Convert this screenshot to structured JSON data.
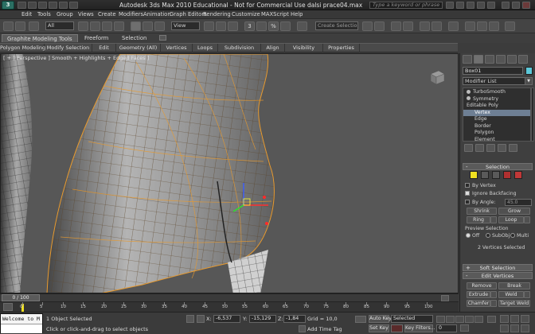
{
  "app": {
    "logo_label": "3",
    "title": "Autodesk 3ds Max  2010  Educational - Not for Commercial Use     dalsi prace04.max",
    "help_search_placeholder": "Type a keyword or phrase"
  },
  "menu": [
    "Edit",
    "Tools",
    "Group",
    "Views",
    "Create",
    "Modifiers",
    "Animation",
    "Graph Editors",
    "Rendering",
    "Customize",
    "MAXScript",
    "Help"
  ],
  "toolbar": {
    "selection_filter": "All",
    "ref_coord": "View",
    "snap_label": "3",
    "percent_snap": "%",
    "named_selection_placeholder": "Create Selection Se"
  },
  "ribbon": {
    "tabs": [
      "Graphite Modeling Tools",
      "Freeform",
      "Selection"
    ],
    "panels": [
      "Polygon Modeling",
      "Modify Selection",
      "Edit",
      "Geometry (All)",
      "Vertices",
      "Loops",
      "Subdivision",
      "Align",
      "Visibility",
      "Properties"
    ]
  },
  "viewport": {
    "label": "[ + ] Perspective  ] Smooth + Highlights + Edged Faces ]"
  },
  "command_panel": {
    "object_name": "Box01",
    "object_color": "#5cc8d9",
    "modifier_list": "Modifier List",
    "stack": [
      {
        "label": "TurboSmooth"
      },
      {
        "label": "Symmetry"
      },
      {
        "label": "Editable Poly"
      },
      {
        "label": "Vertex"
      },
      {
        "label": "Edge"
      },
      {
        "label": "Border"
      },
      {
        "label": "Polygon"
      },
      {
        "label": "Element"
      }
    ],
    "selection": {
      "title": "Selection",
      "by_vertex": "By Vertex",
      "ignore_backfacing": "Ignore Backfacing",
      "by_angle": "By Angle:",
      "angle_value": "45.0",
      "shrink": "Shrink",
      "grow": "Grow",
      "ring": "Ring",
      "loop": "Loop",
      "preview_label": "Preview Selection",
      "off": "Off",
      "subobj": "SubObj",
      "multi": "Multi",
      "status": "2 Vertices Selected"
    },
    "soft_selection": "Soft Selection",
    "edit_vertices": {
      "title": "Edit Vertices",
      "remove": "Remove",
      "break": "Break",
      "extrude": "Extrude",
      "weld": "Weld",
      "chamfer": "Chamfer",
      "target_weld": "Target Weld"
    }
  },
  "timeline": {
    "frame": "0 / 100",
    "ticks": [
      "0",
      "5",
      "10",
      "15",
      "20",
      "25",
      "30",
      "35",
      "40",
      "45",
      "50",
      "55",
      "60",
      "65",
      "70",
      "75",
      "80",
      "85",
      "90",
      "95",
      "100"
    ]
  },
  "status": {
    "maxscript_text": "Welcome to M",
    "selection": "1 Object Selected",
    "hint": "Click or click-and-drag to select objects",
    "x_label": "X:",
    "x": "-6,537",
    "y_label": "Y:",
    "y": "-15,129",
    "z_label": "Z:",
    "z": "-1,84",
    "grid": "Grid = 10,0",
    "add_time_tag": "Add Time Tag",
    "auto_key": "Auto Key",
    "set_key": "Set Key",
    "key_mode": "Selected",
    "key_filters": "Key Filters...",
    "current_frame": "0"
  },
  "colors": {
    "wire_orange": "#e89a2e",
    "selected_vertex": "#ff2a2a",
    "gizmo_x": "#ff3030",
    "gizmo_y": "#2be42b",
    "gizmo_z": "#3a5cff"
  }
}
